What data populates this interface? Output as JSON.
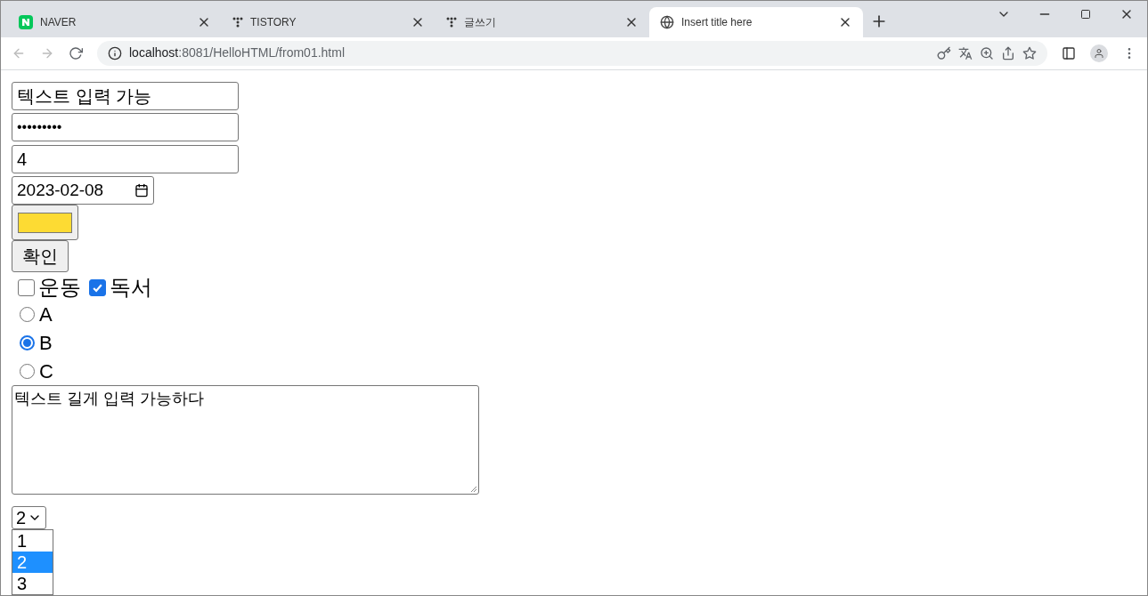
{
  "tabs": [
    {
      "title": "NAVER",
      "kind": "naver",
      "selected": false
    },
    {
      "title": "TISTORY",
      "kind": "tistory",
      "selected": false
    },
    {
      "title": "글쓰기",
      "kind": "tistory",
      "selected": false
    },
    {
      "title": "Insert title here",
      "kind": "globe",
      "selected": true
    }
  ],
  "address_bar": {
    "host": "localhost",
    "rest": ":8081/HelloHTML/from01.html"
  },
  "form": {
    "text_field": {
      "value": "텍스트 입력 가능"
    },
    "password_field": {
      "value": "•••••••••"
    },
    "number_field": {
      "value": "4"
    },
    "date_field": {
      "value": "2023-02-08"
    },
    "color_picker": {
      "color": "#fddb33"
    },
    "submit_button": {
      "label": "확인"
    },
    "checkboxes": [
      {
        "label": "운동",
        "checked": false
      },
      {
        "label": "독서",
        "checked": true
      }
    ],
    "radios": [
      {
        "label": "A",
        "selected": false
      },
      {
        "label": "B",
        "selected": true
      },
      {
        "label": "C",
        "selected": false
      }
    ],
    "textarea": {
      "value": "텍스트 길게 입력 가능하다"
    },
    "select": {
      "value": "2",
      "options": [
        {
          "label": "1",
          "selected": false
        },
        {
          "label": "2",
          "selected": true
        },
        {
          "label": "3",
          "selected": false
        }
      ]
    }
  }
}
